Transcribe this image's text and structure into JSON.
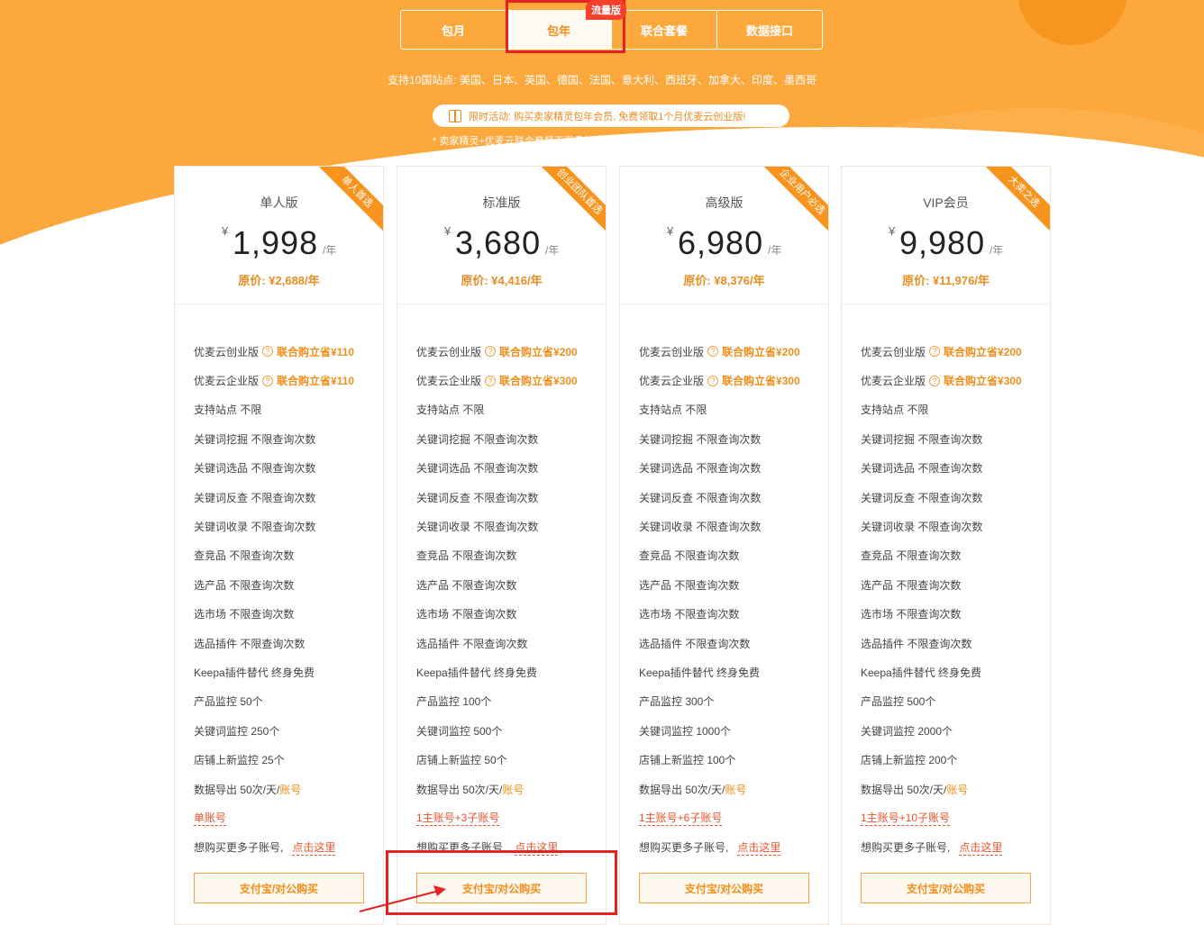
{
  "tabs": [
    {
      "label": "包月",
      "active": false
    },
    {
      "label": "包年",
      "active": true
    },
    {
      "label": "联合套餐",
      "active": false
    },
    {
      "label": "数据接口",
      "active": false
    }
  ],
  "tab_badge": "流量版",
  "sites_text": "支持10国站点: 美国、日本、英国、德国、法国、意大利、西班牙、加拿大、印度、墨西哥",
  "promo_text": "限时活动: 购买卖家精灵包年会员, 免费领取1个月优麦云创业版!",
  "note_text": "* 卖家精灵+优麦云联合套餐不再叠加享受该活动",
  "colors": {
    "accent": "#f08f1b",
    "hero": "#fca83d",
    "highlight": "#e52323"
  },
  "plans": [
    {
      "ribbon": "单人首选",
      "name": "单人版",
      "currency": "¥",
      "price": "1,998",
      "unit": "/年",
      "original": "原价: ¥2,688/年",
      "features": {
        "youmai_startup": "优麦云创业版",
        "youmai_startup_save": "联合购立省¥110",
        "youmai_enterprise": "优麦云企业版",
        "youmai_enterprise_save": "联合购立省¥110",
        "sites": "支持站点 不限",
        "kw_mining": "关键词挖掘 不限查询次数",
        "kw_selection": "关键词选品 不限查询次数",
        "kw_reverse": "关键词反查 不限查询次数",
        "kw_index": "关键词收录 不限查询次数",
        "competitor": "查竞品 不限查询次数",
        "product": "选产品 不限查询次数",
        "market": "选市场 不限查询次数",
        "plugin": "选品插件 不限查询次数",
        "keepa": "Keepa插件替代 终身免费",
        "product_monitor": "产品监控 50个",
        "kw_monitor": "关键词监控 250个",
        "store_monitor": "店铺上新监控 25个",
        "export": "数据导出 50次/天/",
        "export_link": "账号",
        "accounts": "单账号",
        "more_accounts": "想购买更多子账号,",
        "click_here": "点击这里"
      },
      "buy_label": "支付宝/对公购买"
    },
    {
      "ribbon": "创业团队首选",
      "name": "标准版",
      "currency": "¥",
      "price": "3,680",
      "unit": "/年",
      "original": "原价: ¥4,416/年",
      "features": {
        "youmai_startup": "优麦云创业版",
        "youmai_startup_save": "联合购立省¥200",
        "youmai_enterprise": "优麦云企业版",
        "youmai_enterprise_save": "联合购立省¥300",
        "sites": "支持站点 不限",
        "kw_mining": "关键词挖掘 不限查询次数",
        "kw_selection": "关键词选品 不限查询次数",
        "kw_reverse": "关键词反查 不限查询次数",
        "kw_index": "关键词收录 不限查询次数",
        "competitor": "查竞品 不限查询次数",
        "product": "选产品 不限查询次数",
        "market": "选市场 不限查询次数",
        "plugin": "选品插件 不限查询次数",
        "keepa": "Keepa插件替代 终身免费",
        "product_monitor": "产品监控 100个",
        "kw_monitor": "关键词监控 500个",
        "store_monitor": "店铺上新监控 50个",
        "export": "数据导出 50次/天/",
        "export_link": "账号",
        "accounts": "1主账号+3子账号",
        "more_accounts": "想购买更多子账号,",
        "click_here": "点击这里"
      },
      "buy_label": "支付宝/对公购买"
    },
    {
      "ribbon": "企业用户必选",
      "name": "高级版",
      "currency": "¥",
      "price": "6,980",
      "unit": "/年",
      "original": "原价: ¥8,376/年",
      "features": {
        "youmai_startup": "优麦云创业版",
        "youmai_startup_save": "联合购立省¥200",
        "youmai_enterprise": "优麦云企业版",
        "youmai_enterprise_save": "联合购立省¥300",
        "sites": "支持站点 不限",
        "kw_mining": "关键词挖掘 不限查询次数",
        "kw_selection": "关键词选品 不限查询次数",
        "kw_reverse": "关键词反查 不限查询次数",
        "kw_index": "关键词收录 不限查询次数",
        "competitor": "查竞品 不限查询次数",
        "product": "选产品 不限查询次数",
        "market": "选市场 不限查询次数",
        "plugin": "选品插件 不限查询次数",
        "keepa": "Keepa插件替代 终身免费",
        "product_monitor": "产品监控 300个",
        "kw_monitor": "关键词监控 1000个",
        "store_monitor": "店铺上新监控 100个",
        "export": "数据导出 50次/天/",
        "export_link": "账号",
        "accounts": "1主账号+6子账号",
        "more_accounts": "想购买更多子账号,",
        "click_here": "点击这里"
      },
      "buy_label": "支付宝/对公购买"
    },
    {
      "ribbon": "大卖之选",
      "name": "VIP会员",
      "currency": "¥",
      "price": "9,980",
      "unit": "/年",
      "original": "原价: ¥11,976/年",
      "features": {
        "youmai_startup": "优麦云创业版",
        "youmai_startup_save": "联合购立省¥200",
        "youmai_enterprise": "优麦云企业版",
        "youmai_enterprise_save": "联合购立省¥300",
        "sites": "支持站点 不限",
        "kw_mining": "关键词挖掘 不限查询次数",
        "kw_selection": "关键词选品 不限查询次数",
        "kw_reverse": "关键词反查 不限查询次数",
        "kw_index": "关键词收录 不限查询次数",
        "competitor": "查竞品 不限查询次数",
        "product": "选产品 不限查询次数",
        "market": "选市场 不限查询次数",
        "plugin": "选品插件 不限查询次数",
        "keepa": "Keepa插件替代 终身免费",
        "product_monitor": "产品监控 500个",
        "kw_monitor": "关键词监控 2000个",
        "store_monitor": "店铺上新监控 200个",
        "export": "数据导出 50次/天/",
        "export_link": "账号",
        "accounts": "1主账号+10子账号",
        "more_accounts": "想购买更多子账号,",
        "click_here": "点击这里"
      },
      "buy_label": "支付宝/对公购买"
    }
  ]
}
